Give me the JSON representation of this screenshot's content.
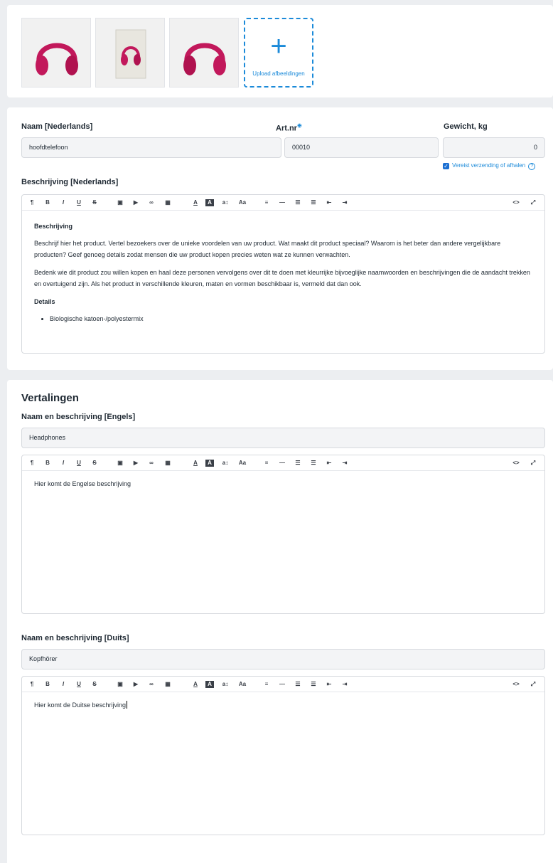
{
  "images": {
    "upload_label": "Upload afbeeldingen",
    "plus_icon": "+",
    "accent": "#1b8ad9"
  },
  "product": {
    "name_label": "Naam [Nederlands]",
    "name_value": "hoofdtelefoon",
    "artnr_label": "Art.nr",
    "artnr_icon": "⊕",
    "artnr_value": "00010",
    "weight_label": "Gewicht, kg",
    "weight_value": "0",
    "shipping_check_label": "Vereist verzending of afhalen",
    "help_icon": "?",
    "description_label": "Beschrijving [Nederlands]",
    "description": {
      "heading": "Beschrijving",
      "p1": "Beschrijf hier het product. Vertel bezoekers over de unieke voordelen van uw product. Wat maakt dit product speciaal? Waarom is het beter dan andere vergelijkbare producten? Geef genoeg details zodat mensen die uw product kopen precies weten wat ze kunnen verwachten.",
      "p2": "Bedenk wie dit product zou willen kopen en haal deze personen vervolgens over dit te doen met kleurrijke bijvoeglijke naamwoorden en beschrijvingen die de aandacht trekken en overtuigend zijn. Als het product in verschillende kleuren, maten en vormen beschikbaar is, vermeld dat dan ook.",
      "details_heading": "Details",
      "bullet1": "Biologische katoen-/polyestermix"
    }
  },
  "toolbar": {
    "paragraph": "¶",
    "bold": "B",
    "italic": "I",
    "underline": "U",
    "strike": "S",
    "image": "▣",
    "video": "▶",
    "link": "∞",
    "table": "▦",
    "font_color": "A",
    "bg_color": "A",
    "font_size": "a↕",
    "font_family": "Aa",
    "align": "≡",
    "hr": "—",
    "ul": "☰",
    "ol": "☰",
    "outdent": "⇤",
    "indent": "⇥",
    "code": "<>",
    "fullscreen": "⤢"
  },
  "translations": {
    "title": "Vertalingen",
    "en_label": "Naam en beschrijving [Engels]",
    "en_name": "Headphones",
    "en_description": "Hier komt de Engelse beschrijving",
    "de_label": "Naam en beschrijving [Duits]",
    "de_name": "Kopfhörer",
    "de_description": "Hier komt de Duitse beschrijving"
  }
}
